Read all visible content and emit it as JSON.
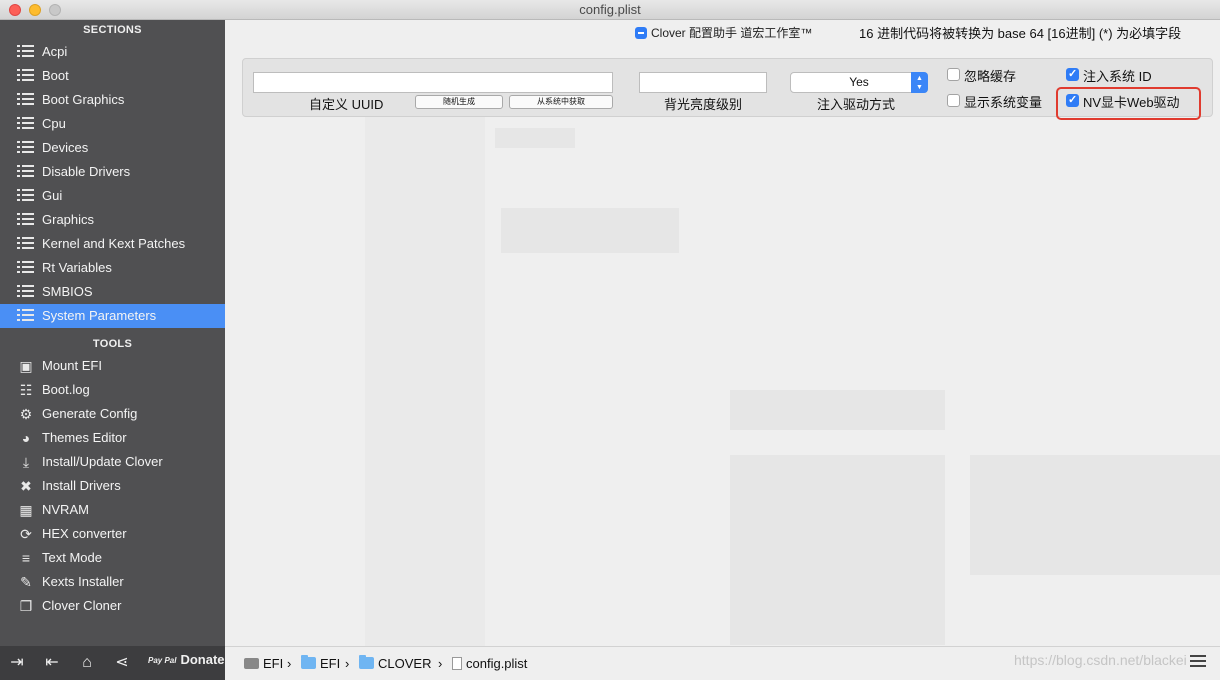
{
  "window": {
    "title": "config.plist"
  },
  "sidebar": {
    "sections_title": "SECTIONS",
    "tools_title": "TOOLS",
    "sections": [
      {
        "label": "Acpi",
        "icon": "list-icon"
      },
      {
        "label": "Boot",
        "icon": "list-icon"
      },
      {
        "label": "Boot Graphics",
        "icon": "list-icon"
      },
      {
        "label": "Cpu",
        "icon": "list-icon"
      },
      {
        "label": "Devices",
        "icon": "list-icon"
      },
      {
        "label": "Disable Drivers",
        "icon": "list-icon"
      },
      {
        "label": "Gui",
        "icon": "list-icon"
      },
      {
        "label": "Graphics",
        "icon": "list-icon"
      },
      {
        "label": "Kernel and Kext Patches",
        "icon": "list-icon"
      },
      {
        "label": "Rt Variables",
        "icon": "list-icon"
      },
      {
        "label": "SMBIOS",
        "icon": "list-icon"
      },
      {
        "label": "System Parameters",
        "icon": "list-icon",
        "active": true
      }
    ],
    "tools": [
      {
        "label": "Mount EFI",
        "icon": "disk-icon",
        "glyph": "▣"
      },
      {
        "label": "Boot.log",
        "icon": "log-icon",
        "glyph": "☷"
      },
      {
        "label": "Generate Config",
        "icon": "gears-icon",
        "glyph": "⚙"
      },
      {
        "label": "Themes Editor",
        "icon": "palette-icon",
        "glyph": "◕"
      },
      {
        "label": "Install/Update Clover",
        "icon": "download-icon",
        "glyph": "⤓"
      },
      {
        "label": "Install Drivers",
        "icon": "tools-icon",
        "glyph": "✖"
      },
      {
        "label": "NVRAM",
        "icon": "chip-icon",
        "glyph": "▦"
      },
      {
        "label": "HEX converter",
        "icon": "refresh-icon",
        "glyph": "⟳"
      },
      {
        "label": "Text Mode",
        "icon": "list-icon",
        "glyph": "≡"
      },
      {
        "label": "Kexts Installer",
        "icon": "plug-icon",
        "glyph": "✎"
      },
      {
        "label": "Clover Cloner",
        "icon": "copy-icon",
        "glyph": "❐"
      }
    ],
    "bottom": {
      "donate_label": "Donate",
      "paypal_label": "Pay Pal"
    }
  },
  "header": {
    "app_label": "Clover 配置助手 道宏工作室™",
    "hint": "16 进制代码将被转换为 base 64 [16进制]   (*) 为必填字段"
  },
  "form": {
    "uuid_label": "自定义 UUID",
    "uuid_value": "",
    "random_button": "随机生成",
    "from_system_button": "从系统中获取",
    "backlight_label": "背光亮度级别",
    "backlight_value": "",
    "inject_kexts_label": "注入驱动方式",
    "inject_kexts_value": "Yes",
    "no_caches_label": "忽略缓存",
    "no_caches_checked": false,
    "show_vars_label": "显示系统变量",
    "show_vars_checked": false,
    "inject_system_id_label": "注入系统 ID",
    "inject_system_id_checked": true,
    "nvidia_web_label": "NV显卡Web驱动",
    "nvidia_web_checked": true
  },
  "pathbar": {
    "items": [
      "EFI",
      "EFI",
      "CLOVER",
      "config.plist"
    ]
  },
  "watermark": "https://blog.csdn.net/blackei",
  "colors": {
    "accent": "#4a8ff5",
    "highlight_box": "#e03b2f",
    "sidebar_bg": "#464648"
  }
}
